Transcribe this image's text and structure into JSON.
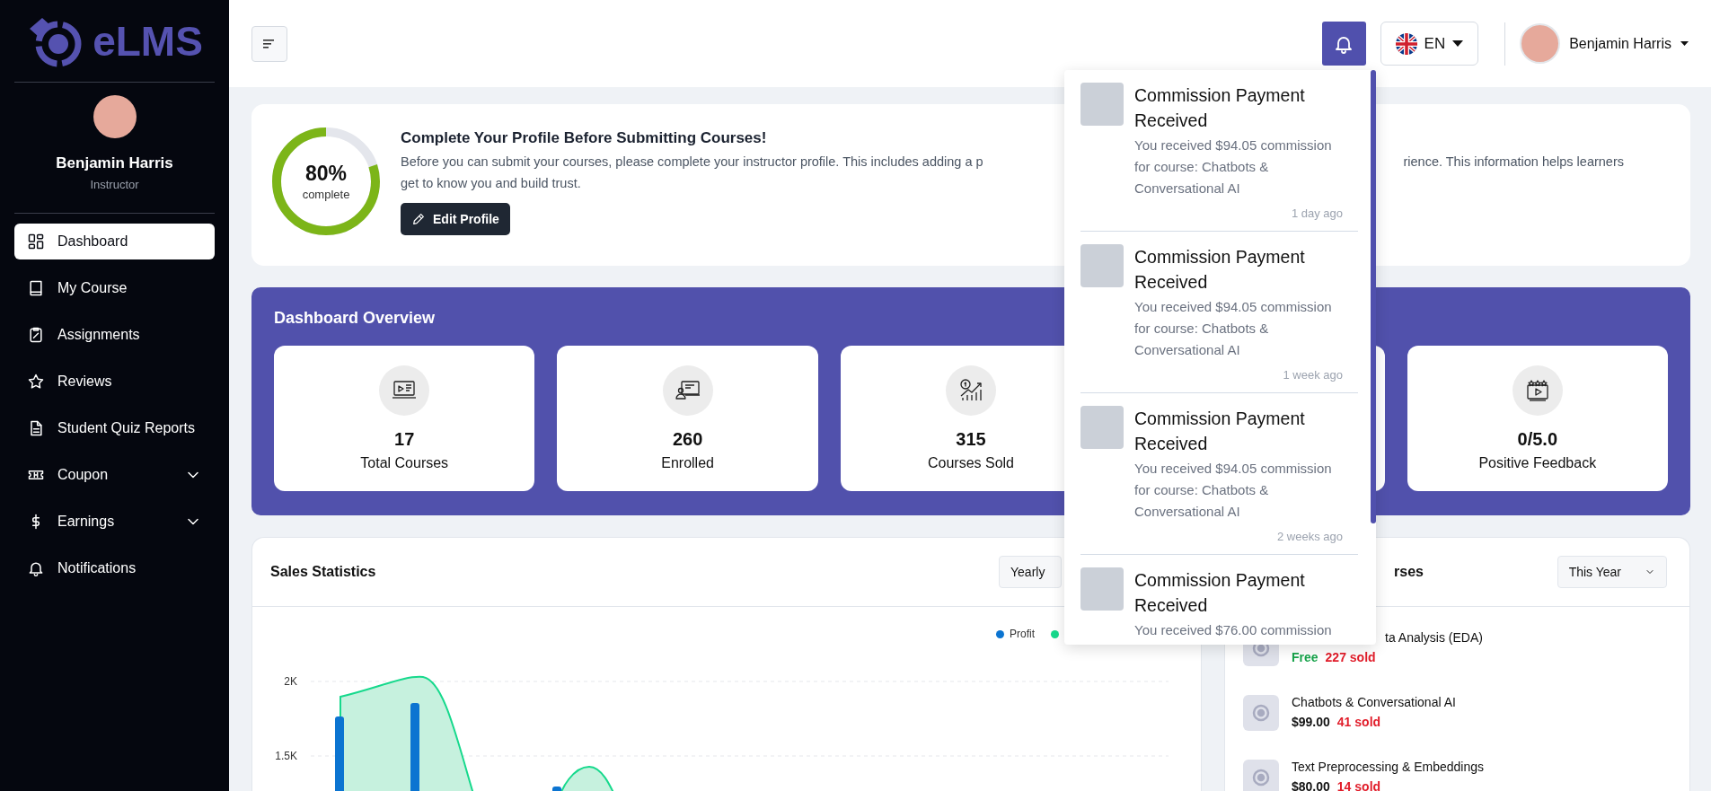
{
  "sidebar": {
    "logo_text": "eLMS",
    "user": {
      "name": "Benjamin Harris",
      "role": "Instructor"
    },
    "nav": [
      {
        "label": "Dashboard",
        "selected": true,
        "expandable": false
      },
      {
        "label": "My Course",
        "selected": false,
        "expandable": false
      },
      {
        "label": "Assignments",
        "selected": false,
        "expandable": false
      },
      {
        "label": "Reviews",
        "selected": false,
        "expandable": false
      },
      {
        "label": "Student Quiz Reports",
        "selected": false,
        "expandable": false
      },
      {
        "label": "Coupon",
        "selected": false,
        "expandable": true
      },
      {
        "label": "Earnings",
        "selected": false,
        "expandable": true
      },
      {
        "label": "Notifications",
        "selected": false,
        "expandable": false
      }
    ]
  },
  "header": {
    "language": "EN",
    "user_name": "Benjamin Harris"
  },
  "profile_prompt": {
    "level": 0.8,
    "percent": "80%",
    "caption": "complete",
    "title": "Complete Your Profile Before Submitting Courses!",
    "text_start": "Before you can submit your courses, please complete your instructor profile. This includes adding a p",
    "text_end": "rience. This information helps learners",
    "text_line_2": "get to know you and build trust.",
    "button": "Edit Profile"
  },
  "overview": {
    "title": "Dashboard Overview",
    "stats": [
      {
        "kind": "stat",
        "value": "17",
        "label": "Total Courses"
      },
      {
        "kind": "stat",
        "value": "260",
        "label": "Enrolled"
      },
      {
        "kind": "stat",
        "value": "315",
        "label": "Courses Sold"
      },
      {
        "kind": "covered"
      },
      {
        "kind": "stat",
        "value": "0/5.0",
        "label": "Positive Feedback"
      }
    ]
  },
  "sales": {
    "title": "Sales Statistics",
    "period": "Yearly",
    "legend": [
      {
        "label": "Profit",
        "color": "#0b74d1"
      },
      {
        "color": "#16d98c"
      }
    ],
    "y_labels": [
      "2K",
      "1.5K"
    ]
  },
  "top_courses": {
    "title": "rses",
    "period": "This Year",
    "items": [
      {
        "title": "ta Analysis (EDA)",
        "price": "Free",
        "free": true,
        "sold": "227 sold"
      },
      {
        "title": "Chatbots & Conversational AI",
        "price": "$99.00",
        "free": false,
        "sold": "41 sold"
      },
      {
        "title": "Text Preprocessing & Embeddings",
        "price": "$80.00",
        "free": false,
        "sold": "14 sold"
      }
    ]
  },
  "notifications": {
    "items": [
      {
        "title": "Commission Payment Received",
        "body": "You received $94.05 commission for course: Chatbots & Conversational AI",
        "time": "1 day ago"
      },
      {
        "title": "Commission Payment Received",
        "body": "You received $94.05 commission for course: Chatbots & Conversational AI",
        "time": "1 week ago"
      },
      {
        "title": "Commission Payment Received",
        "body": "You received $94.05 commission for course: Chatbots & Conversational AI",
        "time": "2 weeks ago"
      },
      {
        "title": "Commission Payment Received",
        "body": "You received $76.00 commission"
      }
    ]
  }
}
